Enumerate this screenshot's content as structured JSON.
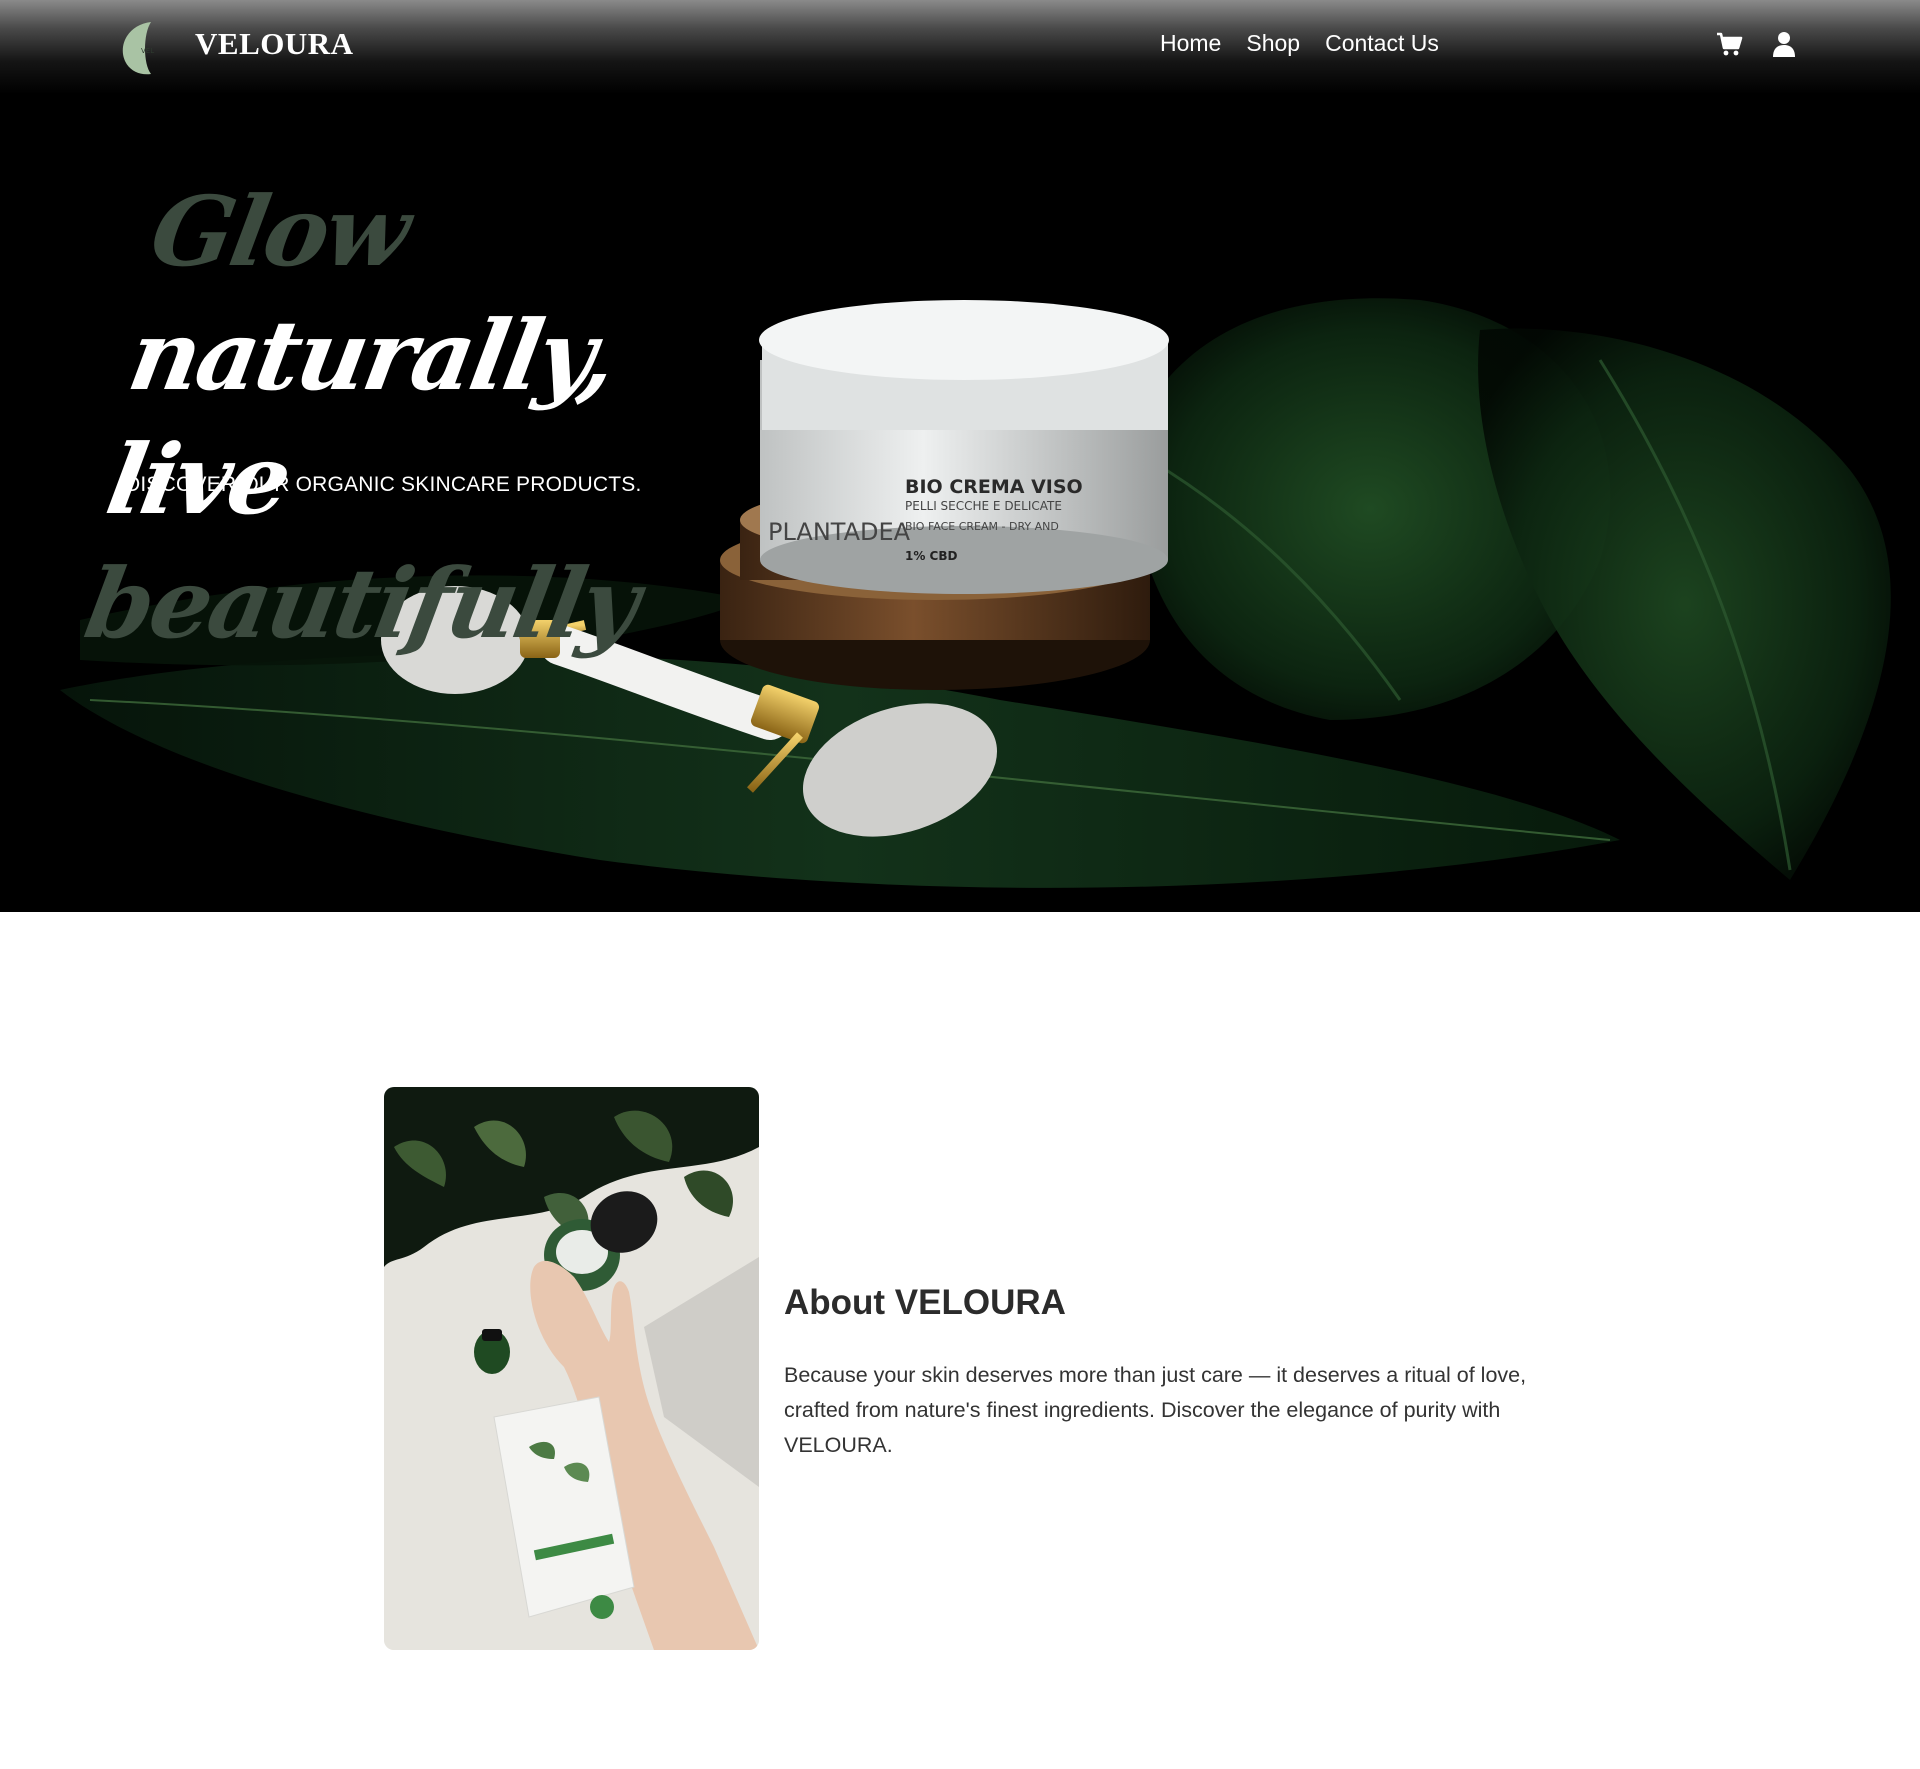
{
  "header": {
    "brand": "VELOURA",
    "nav": {
      "home": "Home",
      "shop": "Shop",
      "contact": "Contact Us"
    },
    "icons": {
      "cart": "cart-icon",
      "account": "user-icon"
    }
  },
  "hero": {
    "headline": {
      "word1": "Glow",
      "word2": "naturally,",
      "word3": "live",
      "word4": "beautifully"
    },
    "tagline": "DISCOVER OUR ORGANIC SKINCARE PRODUCTS.",
    "product_label": {
      "brand": "PLANTADEA",
      "line1": "BIO CREMA VISO",
      "line2": "PELLI SECCHE E DELICATE",
      "line3": "BIO FACE CREAM - DRY AND",
      "line4": "1% CBD"
    }
  },
  "about": {
    "title": "About VELOURA",
    "body": "Because your skin deserves more than just care — it deserves a ritual of love, crafted from nature's finest ingredients. Discover the elegance of purity with VELOURA."
  },
  "colors": {
    "accent_green": "#3b4a3e",
    "logo_green": "#a9c3a4",
    "hero_bg": "#000000"
  }
}
